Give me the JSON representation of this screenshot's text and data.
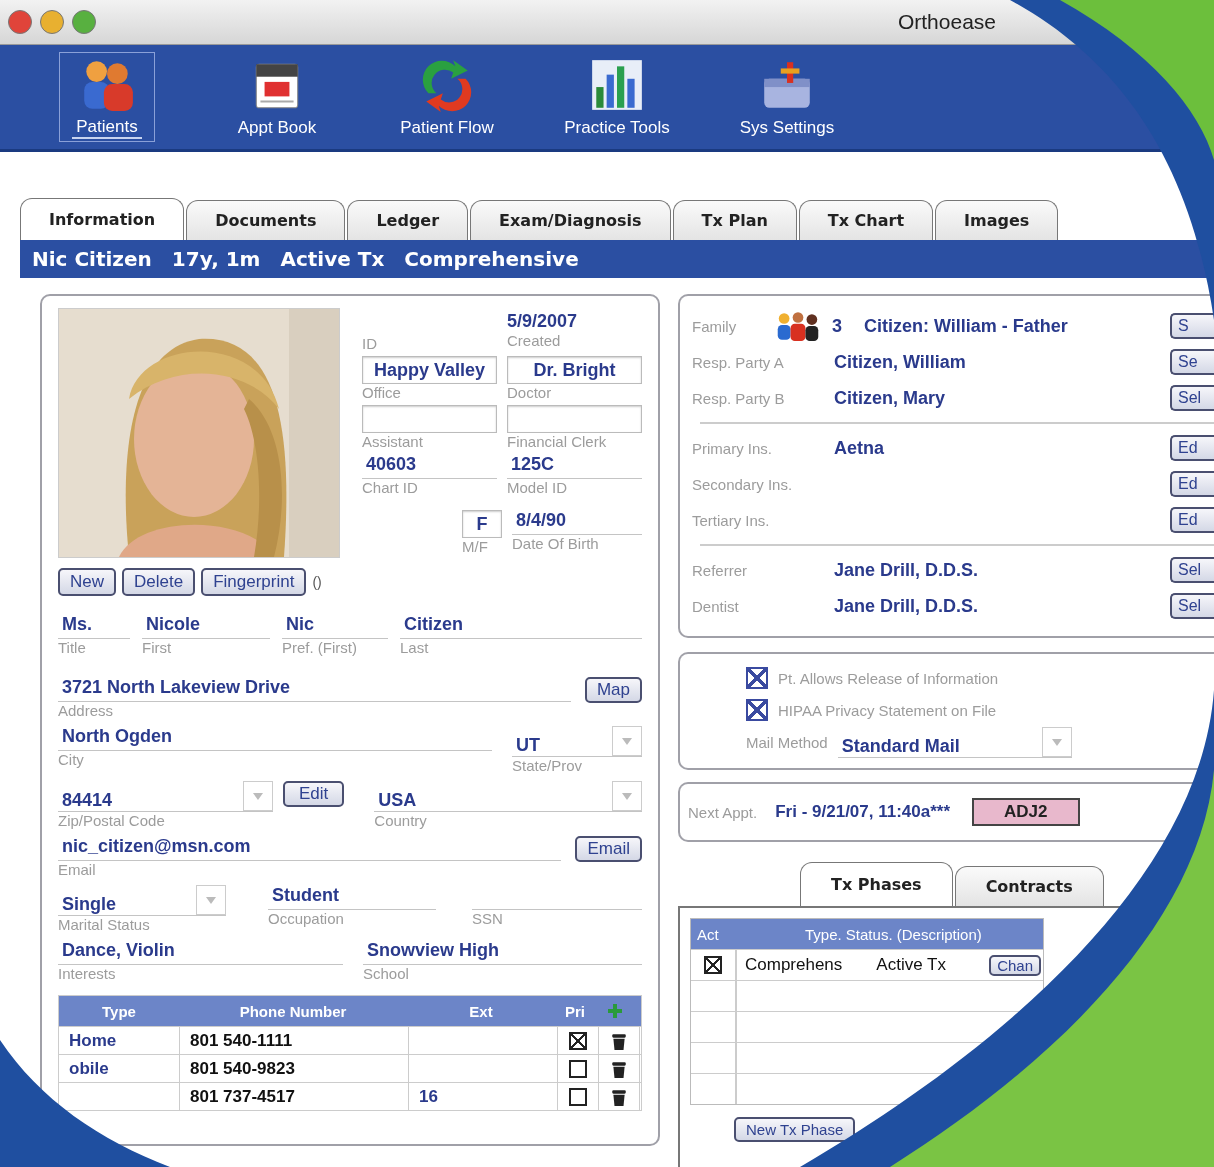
{
  "window": {
    "title": "Orthoease"
  },
  "toolbar": [
    {
      "label": "Patients",
      "selected": true,
      "kind": "patients"
    },
    {
      "label": "Appt Book",
      "selected": false,
      "kind": "calendar"
    },
    {
      "label": "Patient Flow",
      "selected": false,
      "kind": "flow"
    },
    {
      "label": "Practice Tools",
      "selected": false,
      "kind": "chart"
    },
    {
      "label": "Sys Settings",
      "selected": false,
      "kind": "toolbox"
    }
  ],
  "tabs": [
    {
      "label": "Information",
      "selected": true
    },
    {
      "label": "Documents",
      "selected": false
    },
    {
      "label": "Ledger",
      "selected": false
    },
    {
      "label": "Exam/Diagnosis",
      "selected": false
    },
    {
      "label": "Tx Plan",
      "selected": false
    },
    {
      "label": "Tx Chart",
      "selected": false
    },
    {
      "label": "Images",
      "selected": false
    }
  ],
  "patient_bar": [
    "Nic Citizen",
    "17y, 1m",
    "Active Tx",
    "Comprehensive"
  ],
  "record": [
    {
      "kind": "plain",
      "label": "ID"
    },
    {
      "kind": "box",
      "value": "Happy Valley",
      "label": "Office"
    },
    {
      "kind": "box",
      "label": "Assistant"
    },
    {
      "kind": "line",
      "value": "40603",
      "label": "Chart ID"
    },
    {
      "kind": "plain",
      "value": "5/9/2007",
      "label": "Created"
    },
    {
      "kind": "box",
      "value": "Dr. Bright",
      "label": "Doctor"
    },
    {
      "kind": "box",
      "label": "Financial Clerk"
    },
    {
      "kind": "line",
      "value": "125C",
      "label": "Model ID"
    }
  ],
  "sex": {
    "value": "F",
    "label": "M/F"
  },
  "dob": {
    "value": "8/4/90",
    "label": "Date Of Birth"
  },
  "photo_buttons": [
    "New",
    "Delete",
    "Fingerprint"
  ],
  "fingerprint_status": "()",
  "name_fields": [
    {
      "value": "Ms.",
      "label": "Title"
    },
    {
      "value": "Nicole",
      "label": "First"
    },
    {
      "value": "Nic",
      "label": "Pref. (First)"
    },
    {
      "value": "Citizen",
      "label": "Last"
    }
  ],
  "address": {
    "value": "3721 North Lakeview  Drive",
    "label": "Address",
    "button": "Map"
  },
  "city": {
    "value": "North Ogden",
    "label": "City"
  },
  "state": {
    "value": "UT",
    "label": "State/Prov"
  },
  "zip": {
    "value": "84414",
    "label": "Zip/Postal Code",
    "button": "Edit"
  },
  "country": {
    "value": "USA",
    "label": "Country"
  },
  "email": {
    "value": "nic_citizen@msn.com",
    "label": "Email",
    "button": "Email"
  },
  "marital": {
    "value": "Single",
    "label": "Marital Status"
  },
  "occupation": {
    "value": "Student",
    "label": "Occupation"
  },
  "ssn": {
    "label": "SSN"
  },
  "interests": {
    "value": "Dance, Violin",
    "label": "Interests"
  },
  "school": {
    "value": "Snowview High",
    "label": "School"
  },
  "phones": {
    "columns": [
      "Type",
      "Phone Number",
      "Ext",
      "Pri"
    ],
    "rows": [
      {
        "type": "Home",
        "number": "801 540-1111",
        "primary": true
      },
      {
        "type": "obile",
        "number": "801 540-9823",
        "primary": false
      },
      {
        "number": "801 737-4517",
        "ext": "16",
        "primary": false
      }
    ]
  },
  "contacts": [
    {
      "rows": [
        {
          "kind": "family",
          "label": "Family",
          "count": "3",
          "value": "Citizen: William - Father",
          "button": "S"
        },
        {
          "kind": "plain",
          "label": "Resp. Party A",
          "value": "Citizen, William",
          "button": "Se"
        },
        {
          "kind": "plain",
          "label": "Resp. Party B",
          "value": "Citizen, Mary",
          "button": "Sel"
        }
      ]
    },
    {
      "rows": [
        {
          "kind": "plain",
          "label": "Primary Ins.",
          "value": "Aetna",
          "button": "Ed"
        },
        {
          "kind": "plain",
          "label": "Secondary Ins.",
          "button": "Ed"
        },
        {
          "kind": "plain",
          "label": "Tertiary Ins.",
          "button": "Ed"
        }
      ]
    },
    {
      "rows": [
        {
          "kind": "plain",
          "label": "Referrer",
          "value": "Jane Drill, D.D.S.",
          "button": "Sel"
        },
        {
          "kind": "plain",
          "label": "Dentist",
          "value": "Jane Drill, D.D.S.",
          "button": "Sel"
        }
      ]
    }
  ],
  "consents": [
    {
      "label": "Pt. Allows Release of Information",
      "checked": true
    },
    {
      "label": "HIPAA Privacy Statement on File",
      "checked": true
    }
  ],
  "mail_method": {
    "label": "Mail Method",
    "value": "Standard Mail"
  },
  "next_appt": {
    "label": "Next Appt.",
    "value": "Fri - 9/21/07, 11:40a***",
    "code": "ADJ2"
  },
  "sub_tabs": [
    {
      "label": "Tx Phases",
      "selected": true
    },
    {
      "label": "Contracts",
      "selected": false
    }
  ],
  "phases": {
    "columns": [
      "Act",
      "Type. Status. (Description)"
    ],
    "rows": [
      {
        "active": true,
        "type": "Comprehens",
        "status": "Active Tx",
        "button": "Chan"
      }
    ],
    "button": "New Tx Phase"
  }
}
